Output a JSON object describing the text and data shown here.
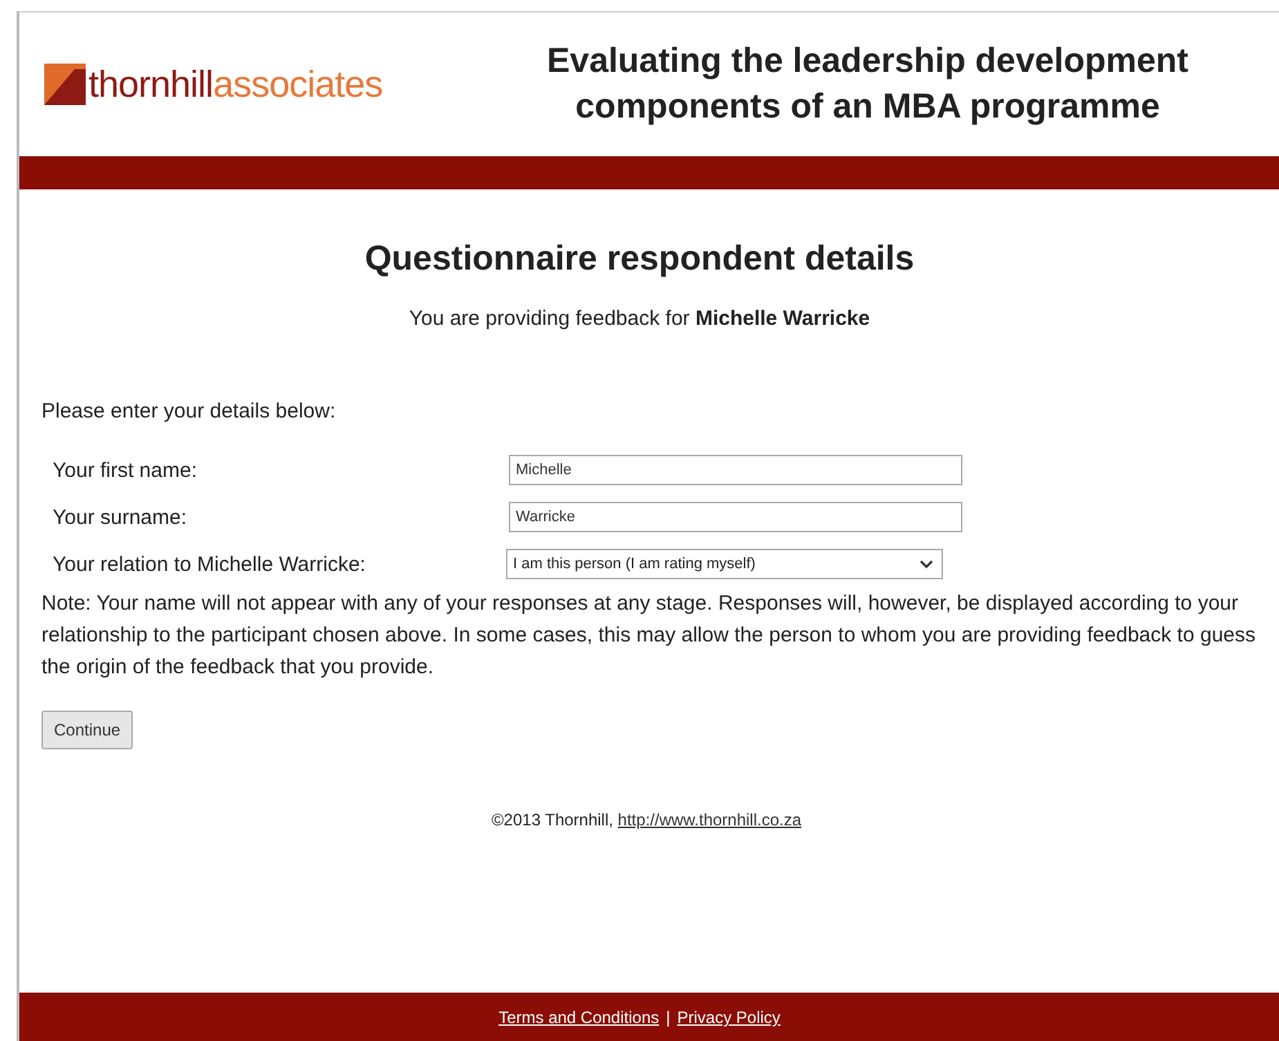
{
  "header": {
    "logo": {
      "first": "thornhill",
      "second": "associates"
    },
    "title_lines": [
      "Evaluating the leadership development",
      "components of an MBA programme"
    ]
  },
  "heading": "Questionnaire respondent details",
  "subtitle": "You are providing feedback for **Michelle Warricke**",
  "intro": "Please enter your details below:",
  "fields": [
    {
      "kind": "text",
      "label": "Your first name:",
      "value": "Michelle"
    },
    {
      "kind": "text",
      "label": "Your surname:",
      "value": "Warricke"
    },
    {
      "kind": "select",
      "label": "Your relation to Michelle Warricke:",
      "value": "I am this person (I am rating myself)"
    }
  ],
  "note": "Note: Your name will not appear with any of your responses at any stage. Responses will, however, be displayed according to your relationship to the participant chosen above. In some cases, this may allow the person to whom you are providing feedback to guess the origin of the feedback that you provide.",
  "button": "Continue",
  "copyright": {
    "text": "©2013 Thornhill,",
    "link": "http://www.thornhill.co.za"
  },
  "footer_links": [
    "Terms and Conditions",
    "Privacy Policy"
  ],
  "footer_separator": "|"
}
